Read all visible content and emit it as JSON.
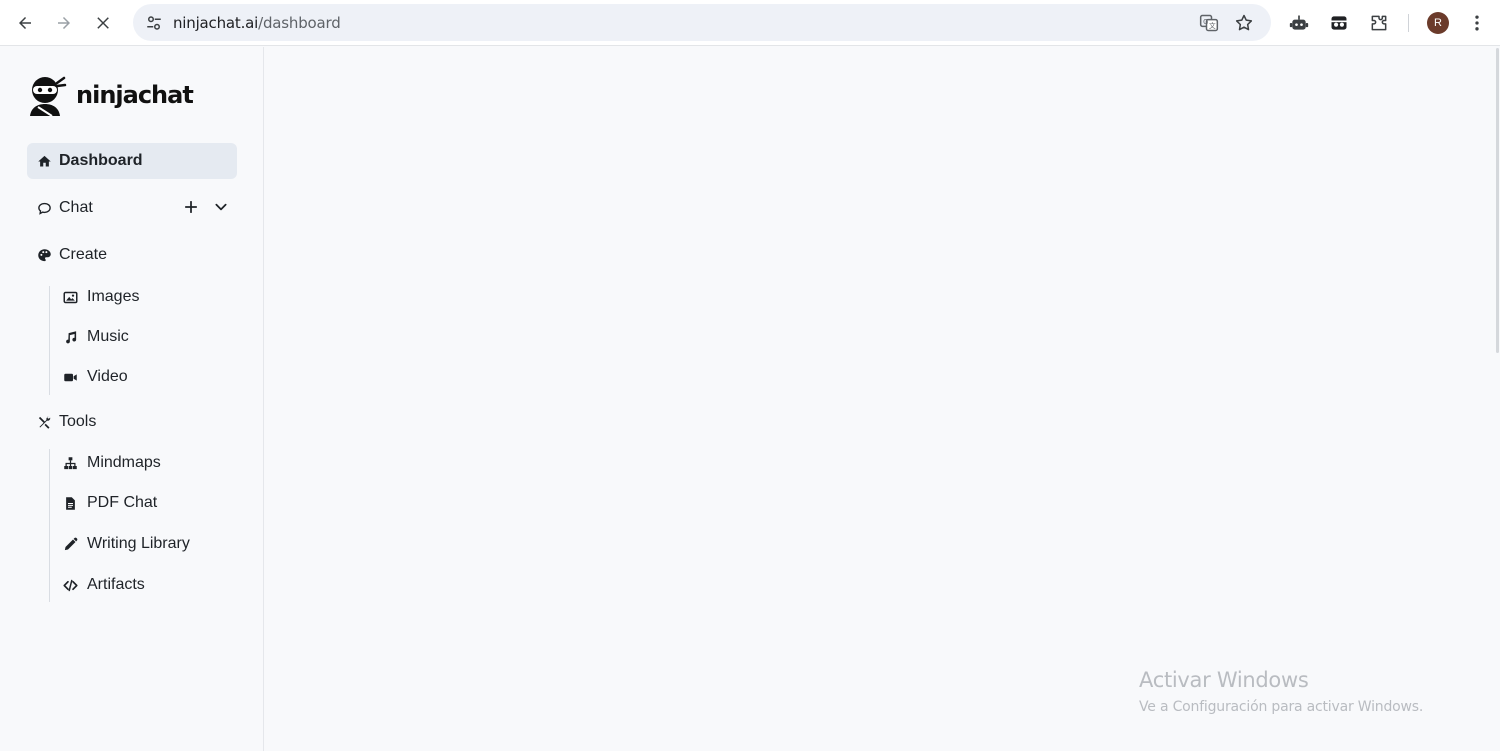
{
  "browser": {
    "url_host": "ninjachat.ai",
    "url_path": "/dashboard",
    "profile_initial": "R"
  },
  "app": {
    "logo_text": "ninjachat"
  },
  "sidebar": {
    "dashboard": "Dashboard",
    "chat": "Chat",
    "create": "Create",
    "create_items": [
      "Images",
      "Music",
      "Video"
    ],
    "tools": "Tools",
    "tools_items": [
      "Mindmaps",
      "PDF Chat",
      "Writing Library",
      "Artifacts"
    ]
  },
  "watermark": {
    "title": "Activar Windows",
    "subtitle": "Ve a Configuración para activar Windows."
  },
  "colors": {
    "active_bg": "#e5eaf1",
    "page_bg": "#f8f9fb"
  }
}
